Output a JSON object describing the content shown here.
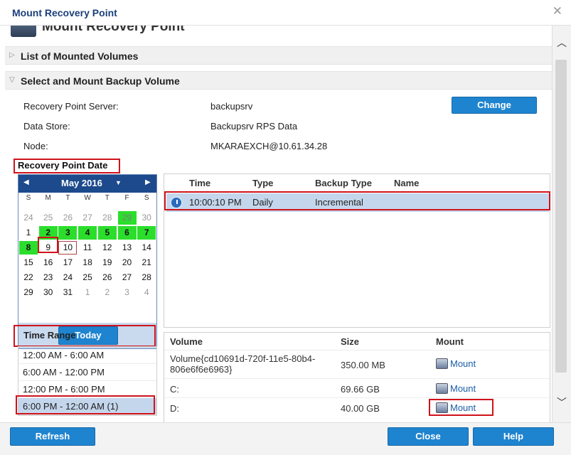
{
  "window": {
    "title": "Mount Recovery Point"
  },
  "header": {
    "title": "Mount Recovery Point"
  },
  "sections": {
    "mounted": "List of Mounted Volumes",
    "select": "Select and Mount Backup Volume"
  },
  "info": {
    "server_label": "Recovery Point Server:",
    "server_value": "backupsrv",
    "store_label": "Data Store:",
    "store_value": "Backupsrv RPS Data",
    "node_label": "Node:",
    "node_value": "MKARAEXCH@10.61.34.28",
    "change_label": "Change"
  },
  "calendar": {
    "label": "Recovery Point Date",
    "month": "May 2016",
    "dows": [
      "S",
      "M",
      "T",
      "W",
      "T",
      "F",
      "S"
    ],
    "days": [
      [
        "24",
        "25",
        "26",
        "27",
        "28",
        "29",
        "30"
      ],
      [
        "1",
        "2",
        "3",
        "4",
        "5",
        "6",
        "7"
      ],
      [
        "8",
        "9",
        "10",
        "11",
        "12",
        "13",
        "14"
      ],
      [
        "15",
        "16",
        "17",
        "18",
        "19",
        "20",
        "21"
      ],
      [
        "22",
        "23",
        "24",
        "25",
        "26",
        "27",
        "28"
      ],
      [
        "29",
        "30",
        "31",
        "1",
        "2",
        "3",
        "4"
      ]
    ],
    "today_label": "Today"
  },
  "time_range": {
    "label": "Time Range",
    "items": [
      "12:00 AM - 6:00 AM",
      "6:00 AM - 12:00 PM",
      "12:00 PM - 6:00 PM",
      "6:00 PM - 12:00 AM   (1)"
    ]
  },
  "recovery_points": {
    "columns": [
      "Time",
      "Type",
      "Backup Type",
      "Name"
    ],
    "rows": [
      {
        "time": "10:00:10 PM",
        "type": "Daily",
        "backup_type": "Incremental",
        "name": ""
      }
    ]
  },
  "volumes": {
    "columns": [
      "Volume",
      "Size",
      "Mount"
    ],
    "rows": [
      {
        "volume": "Volume{cd10691d-720f-11e5-80b4-806e6f6e6963}",
        "size": "350.00 MB",
        "mount": "Mount"
      },
      {
        "volume": "C:",
        "size": "69.66 GB",
        "mount": "Mount"
      },
      {
        "volume": "D:",
        "size": "40.00 GB",
        "mount": "Mount"
      }
    ]
  },
  "footer": {
    "refresh": "Refresh",
    "close": "Close",
    "help": "Help"
  },
  "colors": {
    "accent": "#1f84cf",
    "highlight": "#d0121b",
    "recovery_day": "#2cde2c"
  }
}
